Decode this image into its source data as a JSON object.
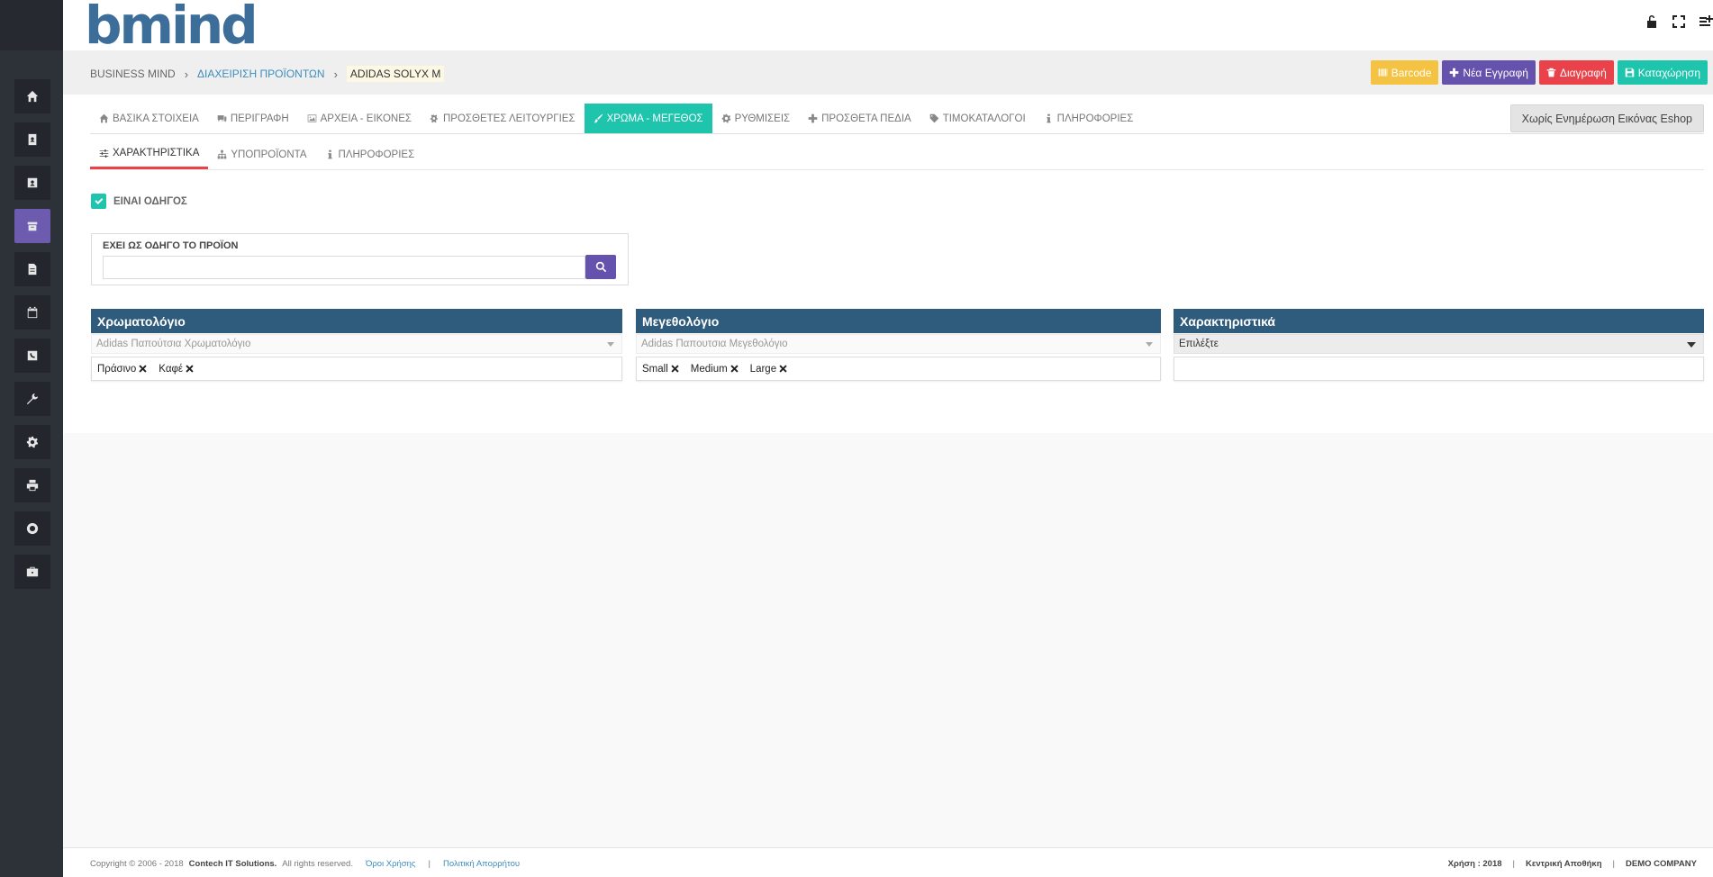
{
  "app": {
    "logo_text": "bmind"
  },
  "breadcrumb": {
    "root": "BUSINESS MIND",
    "section": "ΔΙΑΧΕΙΡΙΣΗ ΠΡΟΪΟΝΤΩΝ",
    "current": "ADIDAS SOLYX M"
  },
  "actions": {
    "barcode": "Barcode",
    "new_record": "Νέα Εγγραφή",
    "delete": "Διαγραφή",
    "save": "Καταχώρηση"
  },
  "tabs": [
    {
      "label": "ΒΑΣΙΚΑ ΣΤΟΙΧΕΙΑ",
      "icon": "home-icon"
    },
    {
      "label": "ΠΕΡΙΓΡΑΦΗ",
      "icon": "comments-icon"
    },
    {
      "label": "ΑΡΧΕΙΑ - ΕΙΚΟΝΕΣ",
      "icon": "image-icon"
    },
    {
      "label": "ΠΡΟΣΘΕΤΕΣ ΛΕΙΤΟΥΡΓΙΕΣ",
      "icon": "cogs-icon"
    },
    {
      "label": "ΧΡΩΜΑ - ΜΕΓΕΘΟΣ",
      "icon": "paint-brush-icon",
      "active": true
    },
    {
      "label": "ΡΥΘΜΙΣΕΙΣ",
      "icon": "gear-icon"
    },
    {
      "label": "ΠΡΟΣΘΕΤΑ ΠΕΔΙΑ",
      "icon": "plus-icon"
    },
    {
      "label": "ΤΙΜΟΚΑΤΑΛΟΓΟΙ",
      "icon": "tag-icon"
    },
    {
      "label": "ΠΛΗΡΟΦΟΡΙΕΣ",
      "icon": "info-icon"
    }
  ],
  "eshop_button": "Χωρίς Ενημέρωση Εικόνας Eshop",
  "subtabs": [
    {
      "label": "ΧΑΡΑΚΤΗΡΙΣΤΙΚΑ",
      "icon": "sliders-icon",
      "active": true
    },
    {
      "label": "ΥΠΟΠΡΟΪΟΝΤΑ",
      "icon": "sitemap-icon"
    },
    {
      "label": "ΠΛΗΡΟΦΟΡΙΕΣ",
      "icon": "info-icon"
    }
  ],
  "is_leader": {
    "label": "ΕΙΝΑΙ ΟΔΗΓΟΣ",
    "checked": true
  },
  "leader_product": {
    "label": "ΕΧΕΙ ΩΣ ΟΔΗΓΟ ΤΟ ΠΡΟΪΟΝ",
    "value": ""
  },
  "panels": {
    "colors": {
      "title": "Χρωματολόγιο",
      "selected": "Adidas Παπούτσια Χρωματολόγιο",
      "tags": [
        "Πράσινο",
        "Καφέ"
      ]
    },
    "sizes": {
      "title": "Μεγεθολόγιο",
      "selected": "Adidas Παπουτσια Μεγεθολόγιο",
      "tags": [
        "Small",
        "Medium",
        "Large"
      ]
    },
    "features": {
      "title": "Χαρακτηριστικά",
      "selected": "Επιλέξτε",
      "tags": []
    }
  },
  "footer": {
    "copyright": "Copyright © 2006 - 2018",
    "company": "Contech IT Solutions.",
    "rights": "All rights reserved.",
    "terms": "Όροι Χρήσης",
    "privacy": "Πολιτική Απορρήτου",
    "fiscal_year": "Χρήση : 2018",
    "warehouse": "Κεντρική Αποθήκη",
    "company_name": "DEMO COMPANY"
  },
  "colors": {
    "primary_blue": "#2f5b7d",
    "teal": "#1fc4ad",
    "purple": "#6552ad",
    "red": "#e9424a",
    "yellow": "#f5c343"
  }
}
